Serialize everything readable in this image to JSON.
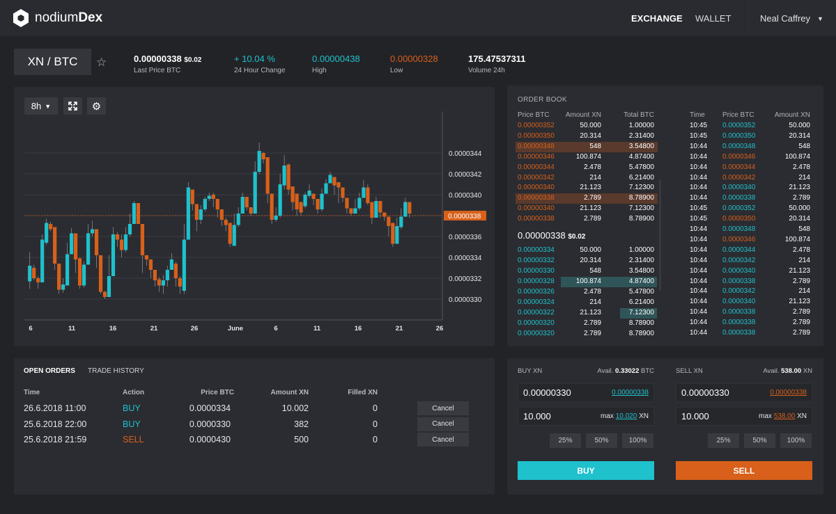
{
  "colors": {
    "accent_buy": "#1fc1cc",
    "accent_sell": "#d8601a",
    "background": "#222327",
    "panel": "#2b2c31"
  },
  "header": {
    "brand_light": "nodium",
    "brand_bold": "Dex",
    "logo_icon": "hexagon-logo-icon",
    "nav": [
      {
        "label": "EXCHANGE",
        "active": true
      },
      {
        "label": "WALLET",
        "active": false
      }
    ],
    "user": "Neal Caffrey"
  },
  "market": {
    "pair": "XN / BTC",
    "last_price": "0.00000338",
    "last_price_usd": "$0.02",
    "last_price_label": "Last Price BTC",
    "change": "+ 10.04 %",
    "change_label": "24 Hour Change",
    "high": "0.00000438",
    "high_label": "High",
    "low": "0.00000328",
    "low_label": "Low",
    "volume": "175.47537311",
    "volume_label": "Volume 24h"
  },
  "chart_toolbar": {
    "interval": "8h",
    "expand_icon": "expand-icon",
    "settings_icon": "gear-icon"
  },
  "chart_data": {
    "type": "candlestick",
    "ylim": [
      3.28e-05,
      3.48e-05
    ],
    "grid": true,
    "y_ticks": [
      "0.0000344",
      "0.0000342",
      "0.0000340",
      "0.0000338",
      "0.0000336",
      "0.0000334",
      "0.0000332",
      "0.0000330"
    ],
    "x_ticks": [
      "6",
      "11",
      "16",
      "21",
      "26",
      "June",
      "6",
      "11",
      "16",
      "21",
      "26"
    ],
    "current_price": "0.0000338",
    "candles_ohlc": [
      [
        3.317e-05,
        3.345e-05,
        3.31e-05,
        3.332e-05
      ],
      [
        3.33e-05,
        3.333e-05,
        3.318e-05,
        3.32e-05
      ],
      [
        3.32e-05,
        3.322e-05,
        3.31e-05,
        3.316e-05
      ],
      [
        3.316e-05,
        3.362e-05,
        3.316e-05,
        3.357e-05
      ],
      [
        3.354e-05,
        3.377e-05,
        3.352e-05,
        3.373e-05
      ],
      [
        3.372e-05,
        3.374e-05,
        3.365e-05,
        3.367e-05
      ],
      [
        3.369e-05,
        3.369e-05,
        3.328e-05,
        3.334e-05
      ],
      [
        3.334e-05,
        3.334e-05,
        3.305e-05,
        3.309e-05
      ],
      [
        3.309e-05,
        3.32e-05,
        3.306e-05,
        3.314e-05
      ],
      [
        3.313e-05,
        3.354e-05,
        3.313e-05,
        3.343e-05
      ],
      [
        3.343e-05,
        3.368e-05,
        3.343e-05,
        3.363e-05
      ],
      [
        3.363e-05,
        3.363e-05,
        3.325e-05,
        3.338e-05
      ],
      [
        3.339e-05,
        3.34e-05,
        3.31e-05,
        3.313e-05
      ],
      [
        3.313e-05,
        3.336e-05,
        3.311e-05,
        3.333e-05
      ],
      [
        3.333e-05,
        3.372e-05,
        3.333e-05,
        3.363e-05
      ],
      [
        3.363e-05,
        3.375e-05,
        3.36e-05,
        3.367e-05
      ],
      [
        3.367e-05,
        3.367e-05,
        3.33e-05,
        3.342e-05
      ],
      [
        3.342e-05,
        3.342e-05,
        3.305e-05,
        3.307e-05
      ],
      [
        3.307e-05,
        3.308e-05,
        3.3e-05,
        3.302e-05
      ],
      [
        3.302e-05,
        3.342e-05,
        3.302e-05,
        3.322e-05
      ],
      [
        3.322e-05,
        3.369e-05,
        3.322e-05,
        3.362e-05
      ],
      [
        3.362e-05,
        3.364e-05,
        3.35e-05,
        3.357e-05
      ],
      [
        3.357e-05,
        3.362e-05,
        3.34e-05,
        3.347e-05
      ],
      [
        3.347e-05,
        3.369e-05,
        3.345e-05,
        3.362e-05
      ],
      [
        3.362e-05,
        3.382e-05,
        3.36e-05,
        3.372e-05
      ],
      [
        3.372e-05,
        3.394e-05,
        3.372e-05,
        3.392e-05
      ],
      [
        3.392e-05,
        3.392e-05,
        3.372e-05,
        3.372e-05
      ],
      [
        3.372e-05,
        3.372e-05,
        3.325e-05,
        3.342e-05
      ],
      [
        3.342e-05,
        3.342e-05,
        3.332e-05,
        3.338e-05
      ],
      [
        3.338e-05,
        3.338e-05,
        3.32e-05,
        3.328e-05
      ],
      [
        3.328e-05,
        3.328e-05,
        3.312e-05,
        3.318e-05
      ],
      [
        3.319e-05,
        3.321e-05,
        3.307e-05,
        3.313e-05
      ],
      [
        3.313e-05,
        3.323e-05,
        3.305e-05,
        3.318e-05
      ],
      [
        3.318e-05,
        3.332e-05,
        3.312e-05,
        3.328e-05
      ],
      [
        3.328e-05,
        3.344e-05,
        3.328e-05,
        3.338e-05
      ],
      [
        3.334e-05,
        3.336e-05,
        3.312e-05,
        3.32e-05
      ],
      [
        3.32e-05,
        3.322e-05,
        3.305e-05,
        3.312e-05
      ],
      [
        3.308e-05,
        3.372e-05,
        3.305e-05,
        3.357e-05
      ],
      [
        3.357e-05,
        3.412e-05,
        3.357e-05,
        3.407e-05
      ],
      [
        3.405e-05,
        3.405e-05,
        3.385e-05,
        3.391e-05
      ],
      [
        3.391e-05,
        3.391e-05,
        3.365e-05,
        3.376e-05
      ],
      [
        3.376e-05,
        3.39e-05,
        3.372e-05,
        3.386e-05
      ],
      [
        3.386e-05,
        3.398e-05,
        3.384e-05,
        3.396e-05
      ],
      [
        3.396e-05,
        3.402e-05,
        3.394e-05,
        3.399e-05
      ],
      [
        3.4e-05,
        3.402e-05,
        3.388e-05,
        3.396e-05
      ],
      [
        3.396e-05,
        3.396e-05,
        3.378e-05,
        3.386e-05
      ],
      [
        3.386e-05,
        3.386e-05,
        3.37e-05,
        3.376e-05
      ],
      [
        3.376e-05,
        3.378e-05,
        3.365e-05,
        3.371e-05
      ],
      [
        3.373e-05,
        3.373e-05,
        3.35e-05,
        3.353e-05
      ],
      [
        3.351e-05,
        3.382e-05,
        3.351e-05,
        3.371e-05
      ],
      [
        3.371e-05,
        3.388e-05,
        3.369e-05,
        3.382e-05
      ],
      [
        3.382e-05,
        3.402e-05,
        3.382e-05,
        3.398e-05
      ],
      [
        3.398e-05,
        3.398e-05,
        3.385e-05,
        3.388e-05
      ],
      [
        3.388e-05,
        3.388e-05,
        3.38e-05,
        3.382e-05
      ],
      [
        3.382e-05,
        3.432e-05,
        3.382e-05,
        3.422e-05
      ],
      [
        3.422e-05,
        3.45e-05,
        3.42e-05,
        3.442e-05
      ],
      [
        3.44e-05,
        3.441e-05,
        3.43e-05,
        3.434e-05
      ],
      [
        3.436e-05,
        3.436e-05,
        3.392e-05,
        3.401e-05
      ],
      [
        3.401e-05,
        3.401e-05,
        3.372e-05,
        3.376e-05
      ],
      [
        3.376e-05,
        3.388e-05,
        3.374e-05,
        3.38e-05
      ],
      [
        3.38e-05,
        3.42e-05,
        3.378e-05,
        3.41e-05
      ],
      [
        3.409e-05,
        3.438e-05,
        3.405e-05,
        3.428e-05
      ],
      [
        3.429e-05,
        3.43e-05,
        3.4e-05,
        3.405e-05
      ],
      [
        3.408e-05,
        3.408e-05,
        3.385e-05,
        3.393e-05
      ],
      [
        3.401e-05,
        3.401e-05,
        3.38e-05,
        3.386e-05
      ],
      [
        3.393e-05,
        3.393e-05,
        3.38e-05,
        3.383e-05
      ],
      [
        3.389e-05,
        3.402e-05,
        3.387e-05,
        3.4e-05
      ],
      [
        3.399e-05,
        3.41e-05,
        3.397e-05,
        3.404e-05
      ],
      [
        3.401e-05,
        3.401e-05,
        3.39e-05,
        3.396e-05
      ],
      [
        3.396e-05,
        3.396e-05,
        3.382e-05,
        3.386e-05
      ],
      [
        3.386e-05,
        3.406e-05,
        3.384e-05,
        3.401e-05
      ],
      [
        3.401e-05,
        3.415e-05,
        3.401e-05,
        3.411e-05
      ],
      [
        3.411e-05,
        3.422e-05,
        3.411e-05,
        3.419e-05
      ],
      [
        3.417e-05,
        3.417e-05,
        3.4e-05,
        3.409e-05
      ],
      [
        3.412e-05,
        3.412e-05,
        3.392e-05,
        3.407e-05
      ],
      [
        3.407e-05,
        3.407e-05,
        3.393e-05,
        3.397e-05
      ],
      [
        3.397e-05,
        3.397e-05,
        3.382e-05,
        3.387e-05
      ],
      [
        3.387e-05,
        3.387e-05,
        3.38e-05,
        3.382e-05
      ],
      [
        3.382e-05,
        3.396e-05,
        3.382e-05,
        3.387e-05
      ],
      [
        3.387e-05,
        3.402e-05,
        3.385e-05,
        3.397e-05
      ],
      [
        3.397e-05,
        3.414e-05,
        3.397e-05,
        3.407e-05
      ],
      [
        3.407e-05,
        3.41e-05,
        3.39e-05,
        3.392e-05
      ],
      [
        3.393e-05,
        3.393e-05,
        3.372e-05,
        3.378e-05
      ],
      [
        3.378e-05,
        3.398e-05,
        3.378e-05,
        3.394e-05
      ],
      [
        3.394e-05,
        3.394e-05,
        3.378e-05,
        3.383e-05
      ],
      [
        3.383e-05,
        3.383e-05,
        3.375e-05,
        3.379e-05
      ],
      [
        3.379e-05,
        3.379e-05,
        3.36e-05,
        3.37e-05
      ],
      [
        3.373e-05,
        3.373e-05,
        3.35e-05,
        3.353e-05
      ],
      [
        3.353e-05,
        3.378e-05,
        3.353e-05,
        3.37e-05
      ],
      [
        3.369e-05,
        3.387e-05,
        3.367e-05,
        3.379e-05
      ],
      [
        3.379e-05,
        3.397e-05,
        3.379e-05,
        3.393e-05
      ],
      [
        3.393e-05,
        3.393e-05,
        3.378e-05,
        3.382e-05
      ]
    ]
  },
  "order_book": {
    "title": "ORDER BOOK",
    "headers": [
      "Price BTC",
      "Amount XN",
      "Total BTC"
    ],
    "asks": [
      [
        "0.00000352",
        "50.000",
        "1.00000"
      ],
      [
        "0.00000350",
        "20.314",
        "2.31400"
      ],
      [
        "0.00000348",
        "548",
        "3.54800"
      ],
      [
        "0.00000346",
        "100.874",
        "4.87400"
      ],
      [
        "0.00000344",
        "2.478",
        "5.47800"
      ],
      [
        "0.00000342",
        "214",
        "6.21400"
      ],
      [
        "0.00000340",
        "21.123",
        "7.12300"
      ],
      [
        "0.00000338",
        "2.789",
        "8.78900"
      ],
      [
        "0.00000340",
        "21.123",
        "7.12300"
      ],
      [
        "0.00000338",
        "2.789",
        "8.78900"
      ]
    ],
    "last_price": "0.00000338",
    "last_price_usd": "$0.02",
    "bids": [
      [
        "0.00000334",
        "50.000",
        "1.00000"
      ],
      [
        "0.00000332",
        "20.314",
        "2.31400"
      ],
      [
        "0.00000330",
        "548",
        "3.54800"
      ],
      [
        "0.00000328",
        "100.874",
        "4.87400"
      ],
      [
        "0.00000326",
        "2.478",
        "5.47800"
      ],
      [
        "0.00000324",
        "214",
        "6.21400"
      ],
      [
        "0.00000322",
        "21.123",
        "7.12300"
      ],
      [
        "0.00000320",
        "2.789",
        "8.78900"
      ],
      [
        "0.00000320",
        "2.789",
        "8.78900"
      ]
    ]
  },
  "trades": {
    "headers": [
      "Time",
      "Price BTC",
      "Amount XN"
    ],
    "rows": [
      [
        "10:45",
        "0.0000352",
        "50.000",
        "buy"
      ],
      [
        "10:45",
        "0.0000350",
        "20.314",
        "buy"
      ],
      [
        "10:44",
        "0.0000348",
        "548",
        "buy"
      ],
      [
        "10:44",
        "0.0000346",
        "100.874",
        "sell"
      ],
      [
        "10:44",
        "0.0000344",
        "2.478",
        "sell"
      ],
      [
        "10:44",
        "0.0000342",
        "214",
        "sell"
      ],
      [
        "10:44",
        "0.0000340",
        "21.123",
        "buy"
      ],
      [
        "10:44",
        "0.0000338",
        "2.789",
        "buy"
      ],
      [
        "10:45",
        "0.0000352",
        "50.000",
        "buy"
      ],
      [
        "10:45",
        "0.0000350",
        "20.314",
        "sell"
      ],
      [
        "10:44",
        "0.0000348",
        "548",
        "buy"
      ],
      [
        "10:44",
        "0.0000346",
        "100.874",
        "sell"
      ],
      [
        "10:44",
        "0.0000344",
        "2.478",
        "buy"
      ],
      [
        "10:44",
        "0.0000342",
        "214",
        "buy"
      ],
      [
        "10:44",
        "0.0000340",
        "21.123",
        "buy"
      ],
      [
        "10:44",
        "0.0000338",
        "2.789",
        "buy"
      ],
      [
        "10:44",
        "0.0000342",
        "214",
        "buy"
      ],
      [
        "10:44",
        "0.0000340",
        "21.123",
        "buy"
      ],
      [
        "10:44",
        "0.0000338",
        "2.789",
        "buy"
      ],
      [
        "10:44",
        "0.0000338",
        "2.789",
        "buy"
      ],
      [
        "10:44",
        "0.0000338",
        "2.789",
        "buy"
      ]
    ]
  },
  "orders": {
    "tabs": [
      "OPEN ORDERS",
      "TRADE HISTORY"
    ],
    "headers": [
      "Time",
      "Action",
      "Price BTC",
      "Amount XN",
      "Filled XN"
    ],
    "cancel_label": "Cancel",
    "rows": [
      [
        "26.6.2018 11:00",
        "BUY",
        "0.0000334",
        "10.002",
        "0"
      ],
      [
        "25.6.2018 22:00",
        "BUY",
        "0.0000330",
        "382",
        "0"
      ],
      [
        "25.6.2018 21:59",
        "SELL",
        "0.0000430",
        "500",
        "0"
      ]
    ]
  },
  "buy": {
    "title": "BUY XN",
    "avail_label": "Avail.",
    "avail_value": "0.33022",
    "avail_unit": "BTC",
    "price": "0.00000330",
    "price_hint": "0.00000338",
    "amount": "10.000",
    "max_label": "max",
    "max_value": "10.020",
    "max_unit": "XN",
    "pcts": [
      "25%",
      "50%",
      "100%"
    ],
    "button": "BUY"
  },
  "sell": {
    "title": "SELL XN",
    "avail_label": "Avail.",
    "avail_value": "538.00",
    "avail_unit": "XN",
    "price": "0.00000330",
    "price_hint": "0.00000338",
    "amount": "10.000",
    "max_label": "max",
    "max_value": "538.00",
    "max_unit": "XN",
    "pcts": [
      "25%",
      "50%",
      "100%"
    ],
    "button": "SELL"
  }
}
